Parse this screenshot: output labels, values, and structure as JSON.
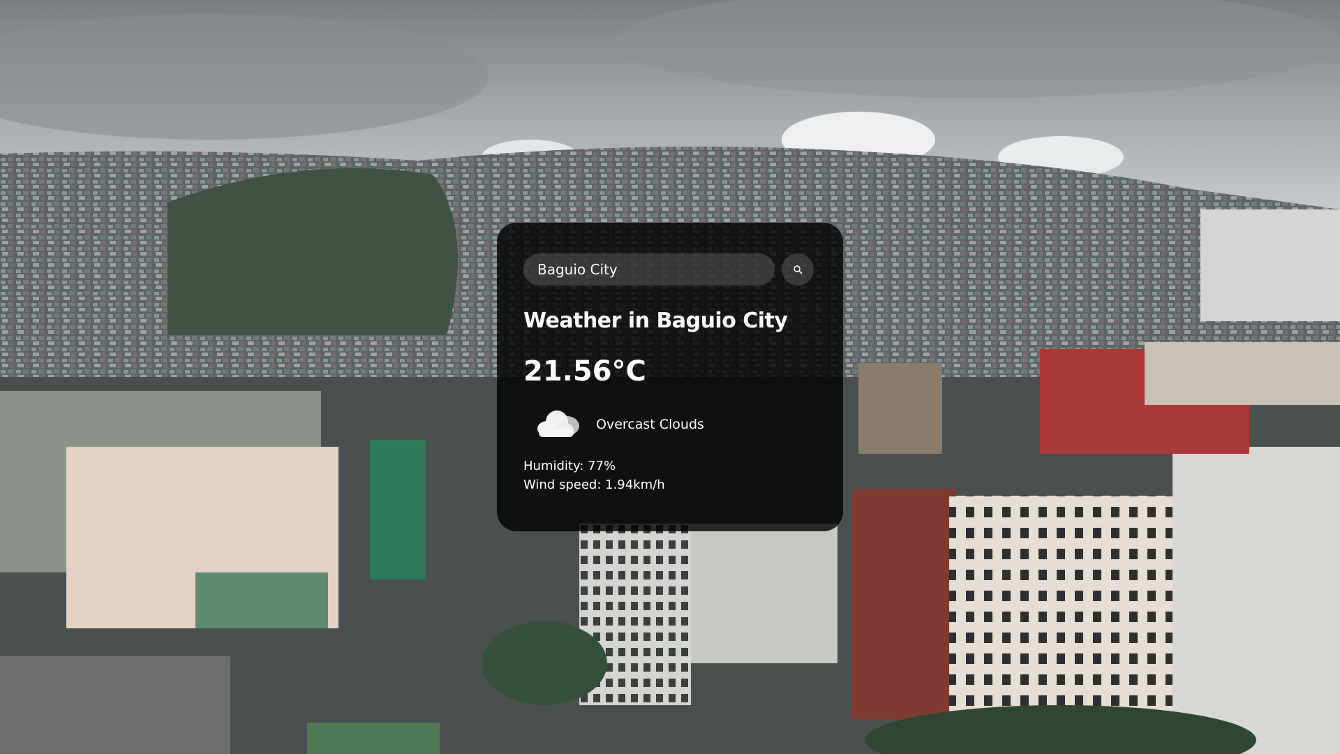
{
  "search": {
    "value": "Baguio City",
    "placeholder": "Search"
  },
  "weather": {
    "title": "Weather in Baguio City",
    "temperature": "21.56°C",
    "description": "Overcast Clouds",
    "icon": "cloud-icon",
    "humidity_label": "Humidity: 77%",
    "wind_label": "Wind speed: 1.94km/h"
  },
  "theme": {
    "card_background": "#000000",
    "text": "#ffffff",
    "input_background": "#7c7c7c"
  },
  "background": {
    "subject": "Baguio City hillside photo with overcast sky"
  }
}
